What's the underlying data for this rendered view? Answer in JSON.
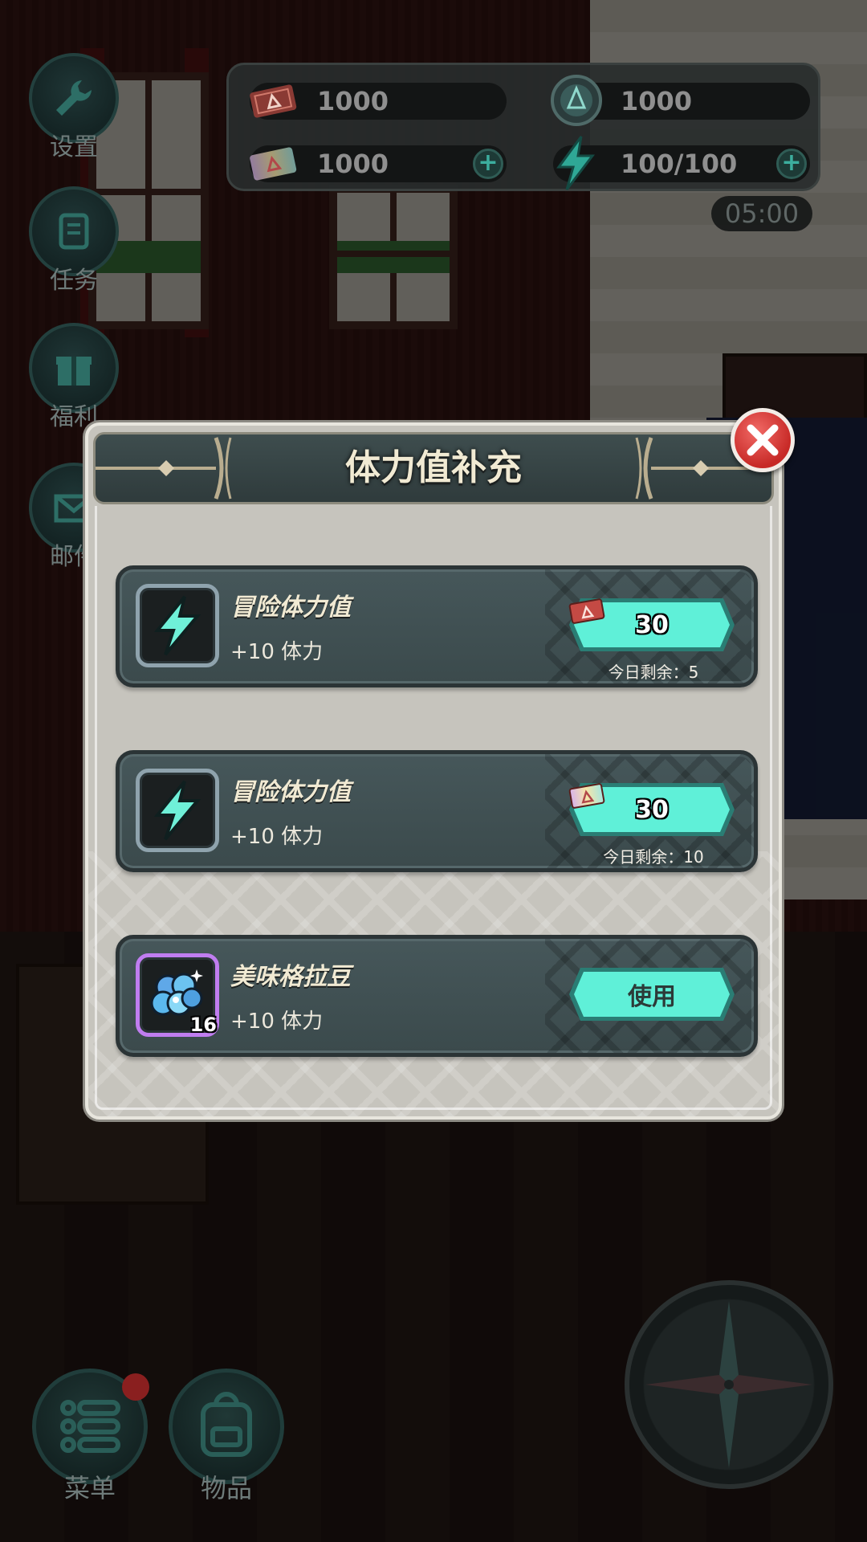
{
  "side_menu": [
    {
      "label": "设置",
      "icon": "wrench-icon"
    },
    {
      "label": "任务",
      "icon": "scroll-icon"
    },
    {
      "label": "福利",
      "icon": "gift-icon"
    },
    {
      "label": "邮件",
      "icon": "mail-icon"
    }
  ],
  "currency": [
    {
      "value": "1000",
      "icon": "red-ticket-icon",
      "has_plus": false
    },
    {
      "value": "1000",
      "icon": "gem-icon",
      "has_plus": false
    },
    {
      "value": "1000",
      "icon": "rainbow-ticket-icon",
      "has_plus": true
    },
    {
      "value": "100/100",
      "icon": "lightning-icon",
      "has_plus": true
    }
  ],
  "timer": "05:00",
  "modal": {
    "title": "体力值补充",
    "offers": [
      {
        "name": "冒险体力值",
        "desc": "+10 体力",
        "price": "30",
        "currency_icon": "red-ticket-icon",
        "remaining": "今日剩余：5"
      },
      {
        "name": "冒险体力值",
        "desc": "+10 体力",
        "price": "30",
        "currency_icon": "rainbow-ticket-icon",
        "remaining": "今日剩余：10"
      },
      {
        "name": "美味格拉豆",
        "desc": "+10 体力",
        "count": "16",
        "action": "使用"
      }
    ]
  },
  "bottom": {
    "menu_label": "菜单",
    "items_label": "物品"
  },
  "colors": {
    "accent_teal": "#3de0c8",
    "title_cream": "#f1ead3",
    "close_red": "#d8302d"
  }
}
